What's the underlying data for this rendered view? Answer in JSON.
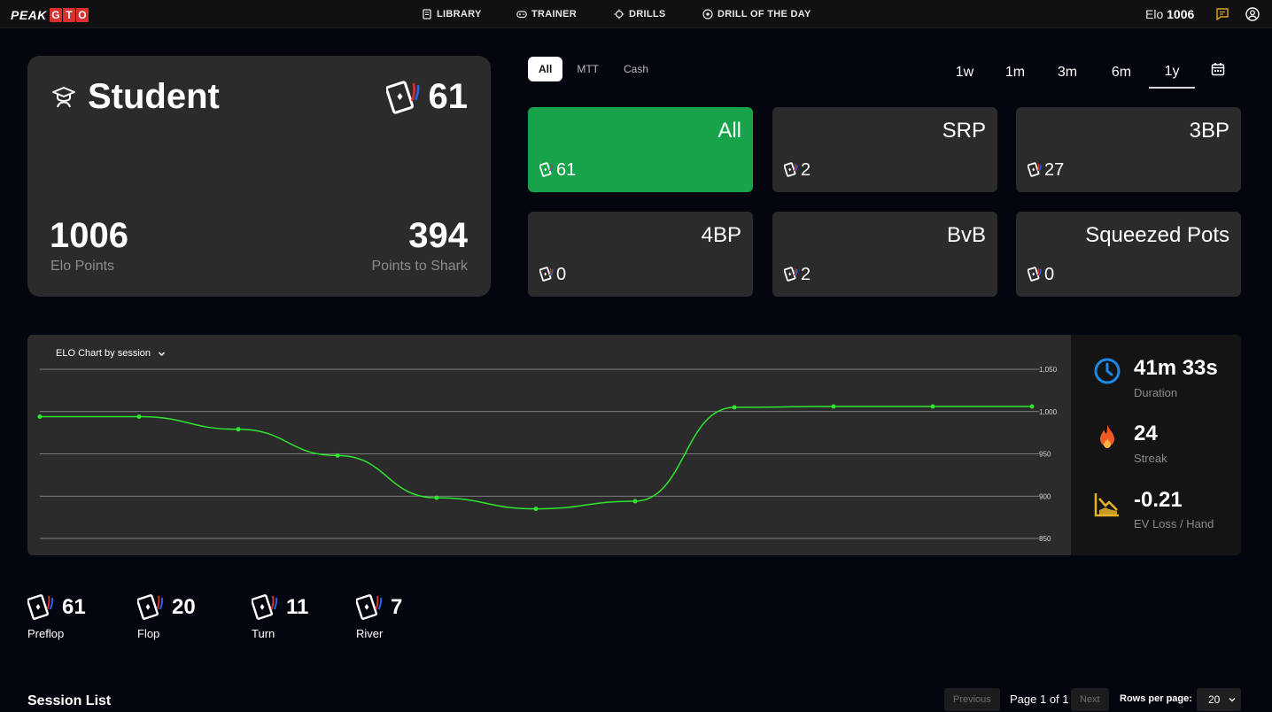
{
  "brand": {
    "logo_peak": "PEAK",
    "logo_gto": [
      "G",
      "T",
      "O"
    ]
  },
  "nav": {
    "library": "LIBRARY",
    "trainer": "TRAINER",
    "drills": "DRILLS",
    "drill_of_the_day": "DRILL OF THE DAY",
    "elo_label": "Elo",
    "elo_value": "1006"
  },
  "profile": {
    "rank": "Student",
    "hands_count": "61",
    "elo_points": "1006",
    "elo_points_label": "Elo Points",
    "points_to_shark": "394",
    "points_to_shark_label": "Points to Shark"
  },
  "game_filter": {
    "tabs": [
      "All",
      "MTT",
      "Cash"
    ],
    "selected": "All"
  },
  "period_filter": {
    "options": [
      "1w",
      "1m",
      "3m",
      "6m",
      "1y"
    ],
    "selected": "1y"
  },
  "pot_types": [
    {
      "name": "All",
      "count": "61",
      "active": true
    },
    {
      "name": "SRP",
      "count": "2",
      "active": false
    },
    {
      "name": "3BP",
      "count": "27",
      "active": false
    },
    {
      "name": "4BP",
      "count": "0",
      "active": false
    },
    {
      "name": "BvB",
      "count": "2",
      "active": false
    },
    {
      "name": "Squeezed Pots",
      "count": "0",
      "active": false
    }
  ],
  "chart_selector": "ELO Chart by session",
  "chart_data": {
    "type": "line",
    "title": "",
    "xlabel": "",
    "ylabel": "",
    "x": [
      1,
      2,
      3,
      4,
      5,
      6,
      7,
      8,
      9,
      10,
      11
    ],
    "series": [
      {
        "values": [
          994,
          994,
          979,
          948,
          898,
          885,
          894,
          1005,
          1006,
          1006,
          1006
        ]
      }
    ],
    "ylim": [
      850,
      1050
    ],
    "y_ticks": [
      "850",
      "900",
      "950",
      "1,000",
      "1,050"
    ],
    "y_axis_side": "right",
    "grid": true,
    "line_color": "#2ee62e"
  },
  "stats": {
    "duration": "41m 33s",
    "duration_label": "Duration",
    "streak": "24",
    "streak_label": "Streak",
    "ev_loss": "-0.21",
    "ev_loss_label": "EV Loss / Hand"
  },
  "streets": [
    {
      "count": "61",
      "label": "Preflop"
    },
    {
      "count": "20",
      "label": "Flop"
    },
    {
      "count": "11",
      "label": "Turn"
    },
    {
      "count": "7",
      "label": "River"
    }
  ],
  "session_list": {
    "title": "Session List",
    "previous": "Previous",
    "page_info": "Page 1 of 1",
    "next": "Next",
    "rows_per_page_label": "Rows per page:",
    "rows_per_page": "20"
  },
  "colors": {
    "accent_green": "#16a34a",
    "panel": "#2b2b2b",
    "background": "#03060e",
    "card_red": "#d9302f",
    "card_blue": "#2563eb"
  }
}
